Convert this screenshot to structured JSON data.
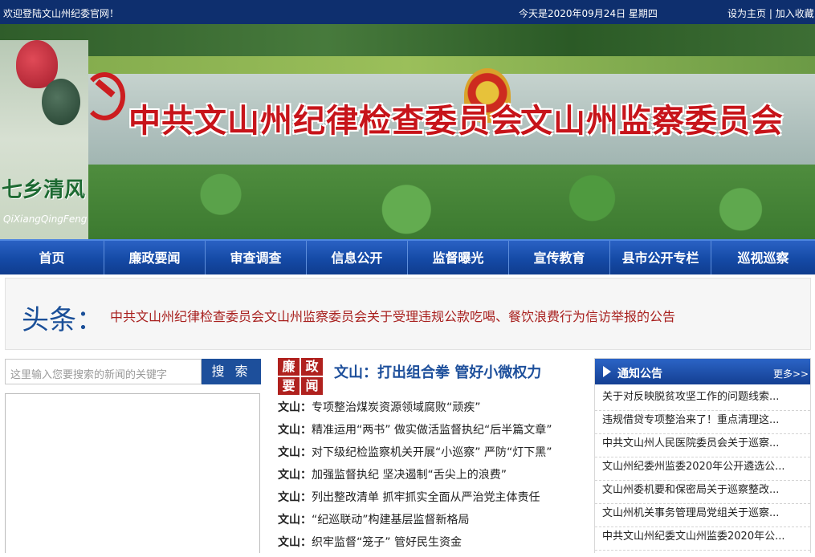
{
  "topbar": {
    "welcome": "欢迎登陆文山州纪委官网！",
    "date": "今天是2020年09月24日 星期四",
    "set_home": "设为主页",
    "separator": " | ",
    "favorite": "加入收藏"
  },
  "banner": {
    "title_left": "中共文山州纪律检查委员会",
    "title_right": "文山州监察委员会",
    "slogan": "七乡清风",
    "slogan_pinyin": "QiXiangQingFeng"
  },
  "nav": {
    "items": [
      "首页",
      "廉政要闻",
      "审查调查",
      "信息公开",
      "监督曝光",
      "宣传教育",
      "县市公开专栏",
      "巡视巡察"
    ]
  },
  "headline": {
    "label": "头条：",
    "text": "中共文山州纪律检查委员会文山州监察委员会关于受理违规公款吃喝、餐饮浪费行为信访举报的公告"
  },
  "search": {
    "placeholder": "这里输入您要搜索的新闻的关键字",
    "button": "搜 索"
  },
  "news": {
    "tag": [
      "廉",
      "政",
      "要",
      "闻"
    ],
    "top_title": "文山：打出组合拳 管好小微权力",
    "items": [
      {
        "prefix": "文山：",
        "title": "专项整治煤炭资源领域腐败“顽疾”"
      },
      {
        "prefix": "文山：",
        "title": "精准运用“两书” 做实做活监督执纪“后半篇文章”"
      },
      {
        "prefix": "文山：",
        "title": "对下级纪检监察机关开展“小巡察” 严防“灯下黑”"
      },
      {
        "prefix": "文山：",
        "title": "加强监督执纪 坚决遏制“舌尖上的浪费”"
      },
      {
        "prefix": "文山：",
        "title": "列出整改清单 抓牢抓实全面从严治党主体责任"
      },
      {
        "prefix": "文山：",
        "title": "“纪巡联动”构建基层监督新格局"
      },
      {
        "prefix": "文山：",
        "title": "织牢监督“笼子” 管好民生资金"
      }
    ]
  },
  "notice": {
    "title": "通知公告",
    "more": "更多>>",
    "items": [
      "关于对反映脱贫攻坚工作的问题线索...",
      "违规借贷专项整治来了！重点清理这...",
      "中共文山州人民医院委员会关于巡察...",
      "文山州纪委州监委2020年公开遴选公...",
      "文山州委机要和保密局关于巡察整改...",
      "文山州机关事务管理局党组关于巡察...",
      "中共文山州纪委文山州监委2020年公..."
    ]
  }
}
